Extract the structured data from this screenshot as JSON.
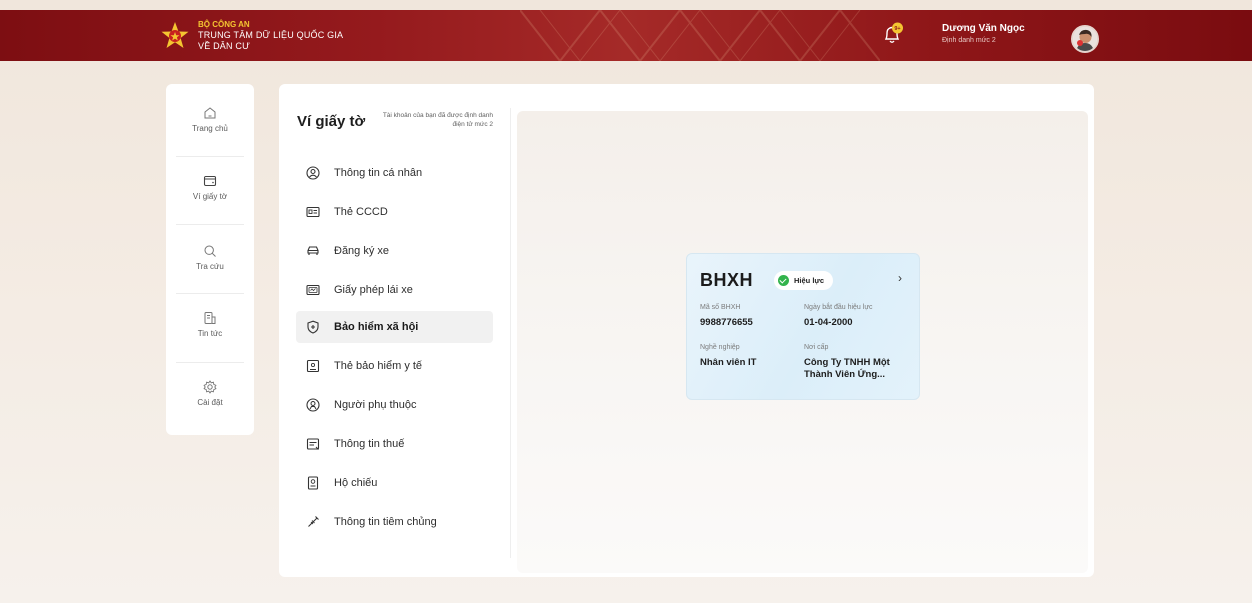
{
  "header": {
    "org_line1": "BỘ CÔNG AN",
    "org_line2": "TRUNG TÂM DỮ LIỆU QUỐC GIA",
    "org_line3": "VỀ DÂN CƯ",
    "notification_badge": "9+",
    "user_name": "Dương Văn Ngọc",
    "user_level": "Định danh mức 2",
    "bg_color": "#8e1618",
    "accent_color": "#f4c531"
  },
  "nav": {
    "items": [
      {
        "label": "Trang chủ",
        "icon": "home-icon"
      },
      {
        "label": "Ví giấy tờ",
        "icon": "wallet-icon"
      },
      {
        "label": "Tra cứu",
        "icon": "search-icon"
      },
      {
        "label": "Tin tức",
        "icon": "news-icon"
      },
      {
        "label": "Cài đặt",
        "icon": "settings-icon"
      }
    ]
  },
  "wallet": {
    "title": "Ví giấy tờ",
    "note": "Tài khoản của bạn đã được định danh điện tử mức 2",
    "active_index": 4,
    "menu": [
      {
        "label": "Thông tin cá nhân",
        "icon": "person-icon"
      },
      {
        "label": "Thẻ CCCD",
        "icon": "id-card-icon"
      },
      {
        "label": "Đăng ký xe",
        "icon": "car-icon"
      },
      {
        "label": "Giấy phép lái xe",
        "icon": "license-icon"
      },
      {
        "label": "Bảo hiểm xã hội",
        "icon": "shield-plus-icon"
      },
      {
        "label": "Thẻ bảo hiểm y tế",
        "icon": "health-card-icon"
      },
      {
        "label": "Người phụ thuộc",
        "icon": "dependent-icon"
      },
      {
        "label": "Thông tin thuế",
        "icon": "tax-icon"
      },
      {
        "label": "Hộ chiếu",
        "icon": "passport-icon"
      },
      {
        "label": "Thông tin tiêm chủng",
        "icon": "vaccine-icon"
      }
    ]
  },
  "card": {
    "title": "BHXH",
    "status": "Hiệu lực",
    "status_color": "#32b34c",
    "fields": [
      {
        "label": "Mã số BHXH",
        "value": "9988776655"
      },
      {
        "label": "Ngày bắt đầu hiệu lực",
        "value": "01-04-2000"
      },
      {
        "label": "Nghề nghiệp",
        "value": "Nhân viên IT"
      },
      {
        "label": "Nơi cấp",
        "value": "Công Ty TNHH Một Thành Viên Ứng..."
      }
    ]
  }
}
